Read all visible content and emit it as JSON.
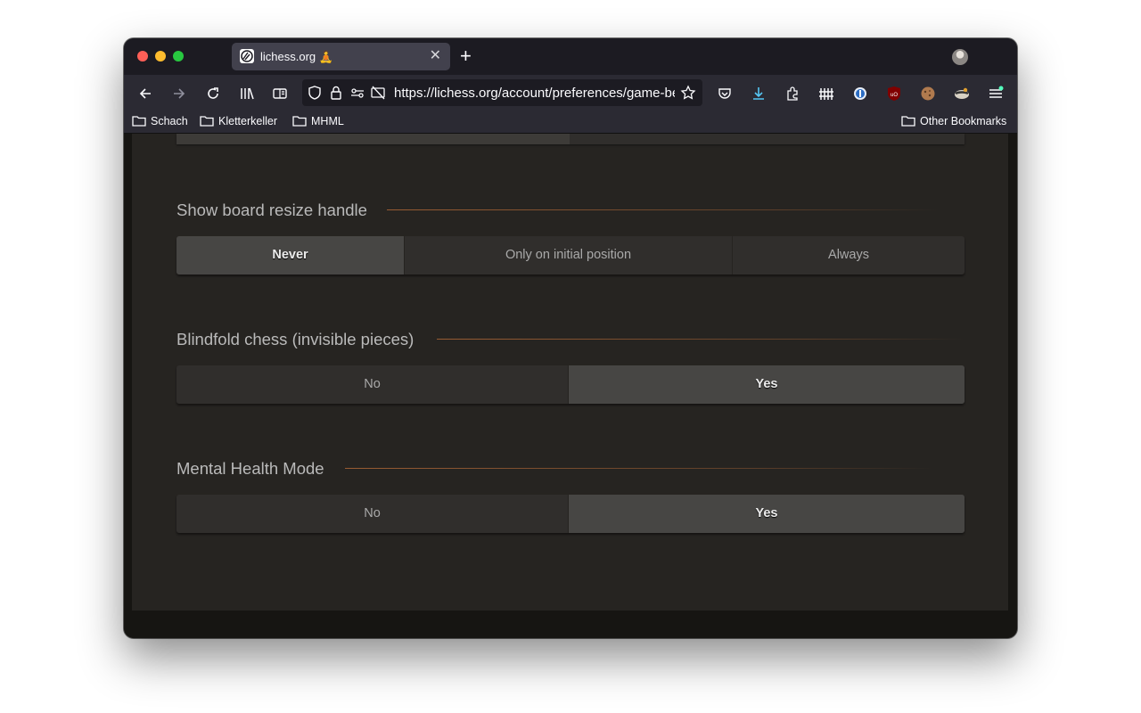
{
  "browser": {
    "tab": {
      "title": "lichess.org 🧘"
    },
    "url": "https://lichess.org/account/preferences/game-behavior",
    "bookmarks": [
      "Schach",
      "Kletterkeller",
      "MHML"
    ],
    "other_bookmarks": "Other Bookmarks",
    "icons": [
      "back-icon",
      "forward-icon",
      "reload-icon",
      "library-icon",
      "sidebar-icon",
      "shield-icon",
      "lock-icon",
      "permissions-icon",
      "tracking-off-icon",
      "star-icon",
      "pocket-icon",
      "download-icon",
      "extensions-icon",
      "fence-icon",
      "onepassword-icon",
      "ublock-icon",
      "cookie-icon",
      "raccoon-icon",
      "menu-icon"
    ]
  },
  "prefs": {
    "resize": {
      "title": "Show board resize handle",
      "options": [
        "Never",
        "Only on initial position",
        "Always"
      ],
      "selected": "Never"
    },
    "blindfold": {
      "title": "Blindfold chess (invisible pieces)",
      "options": [
        "No",
        "Yes"
      ],
      "selected": "Yes"
    },
    "mental": {
      "title": "Mental Health Mode",
      "options": [
        "No",
        "Yes"
      ],
      "selected": "Yes"
    }
  },
  "colors": {
    "accent": "#bf6f39",
    "panel": "#262421",
    "selected": "#474644"
  }
}
